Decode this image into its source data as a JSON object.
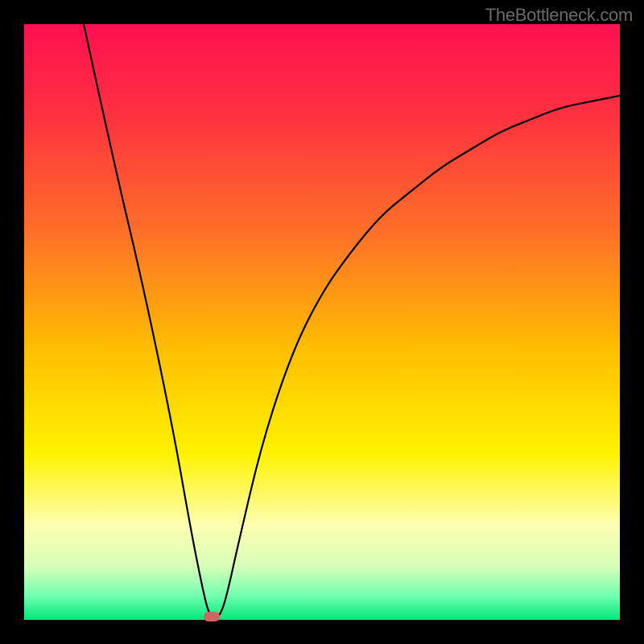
{
  "watermark": "TheBottleneck.com",
  "chart_data": {
    "type": "line",
    "title": "",
    "xlabel": "",
    "ylabel": "",
    "xlim": [
      0,
      100
    ],
    "ylim": [
      0,
      100
    ],
    "grid": false,
    "legend": false,
    "series": [
      {
        "name": "bottleneck-curve",
        "x": [
          10,
          15,
          20,
          25,
          28,
          30,
          31,
          32,
          33,
          34,
          36,
          40,
          45,
          50,
          55,
          60,
          65,
          70,
          75,
          80,
          85,
          90,
          95,
          100
        ],
        "y": [
          100,
          77,
          56,
          32,
          15,
          5,
          1,
          0,
          1,
          4,
          13,
          30,
          45,
          55,
          62,
          68,
          72,
          76,
          79,
          82,
          84,
          86,
          87,
          88
        ]
      }
    ],
    "marker": {
      "x": 31.5,
      "y": 0.5,
      "color": "#c86a62"
    },
    "background_gradient": {
      "stops": [
        {
          "offset": 0.0,
          "color": "#ff1050"
        },
        {
          "offset": 0.15,
          "color": "#ff3040"
        },
        {
          "offset": 0.35,
          "color": "#ff7028"
        },
        {
          "offset": 0.55,
          "color": "#ffc000"
        },
        {
          "offset": 0.72,
          "color": "#fff200"
        },
        {
          "offset": 0.84,
          "color": "#fdffb0"
        },
        {
          "offset": 0.91,
          "color": "#d8ffb8"
        },
        {
          "offset": 0.96,
          "color": "#70ffb0"
        },
        {
          "offset": 1.0,
          "color": "#00e878"
        }
      ]
    }
  }
}
